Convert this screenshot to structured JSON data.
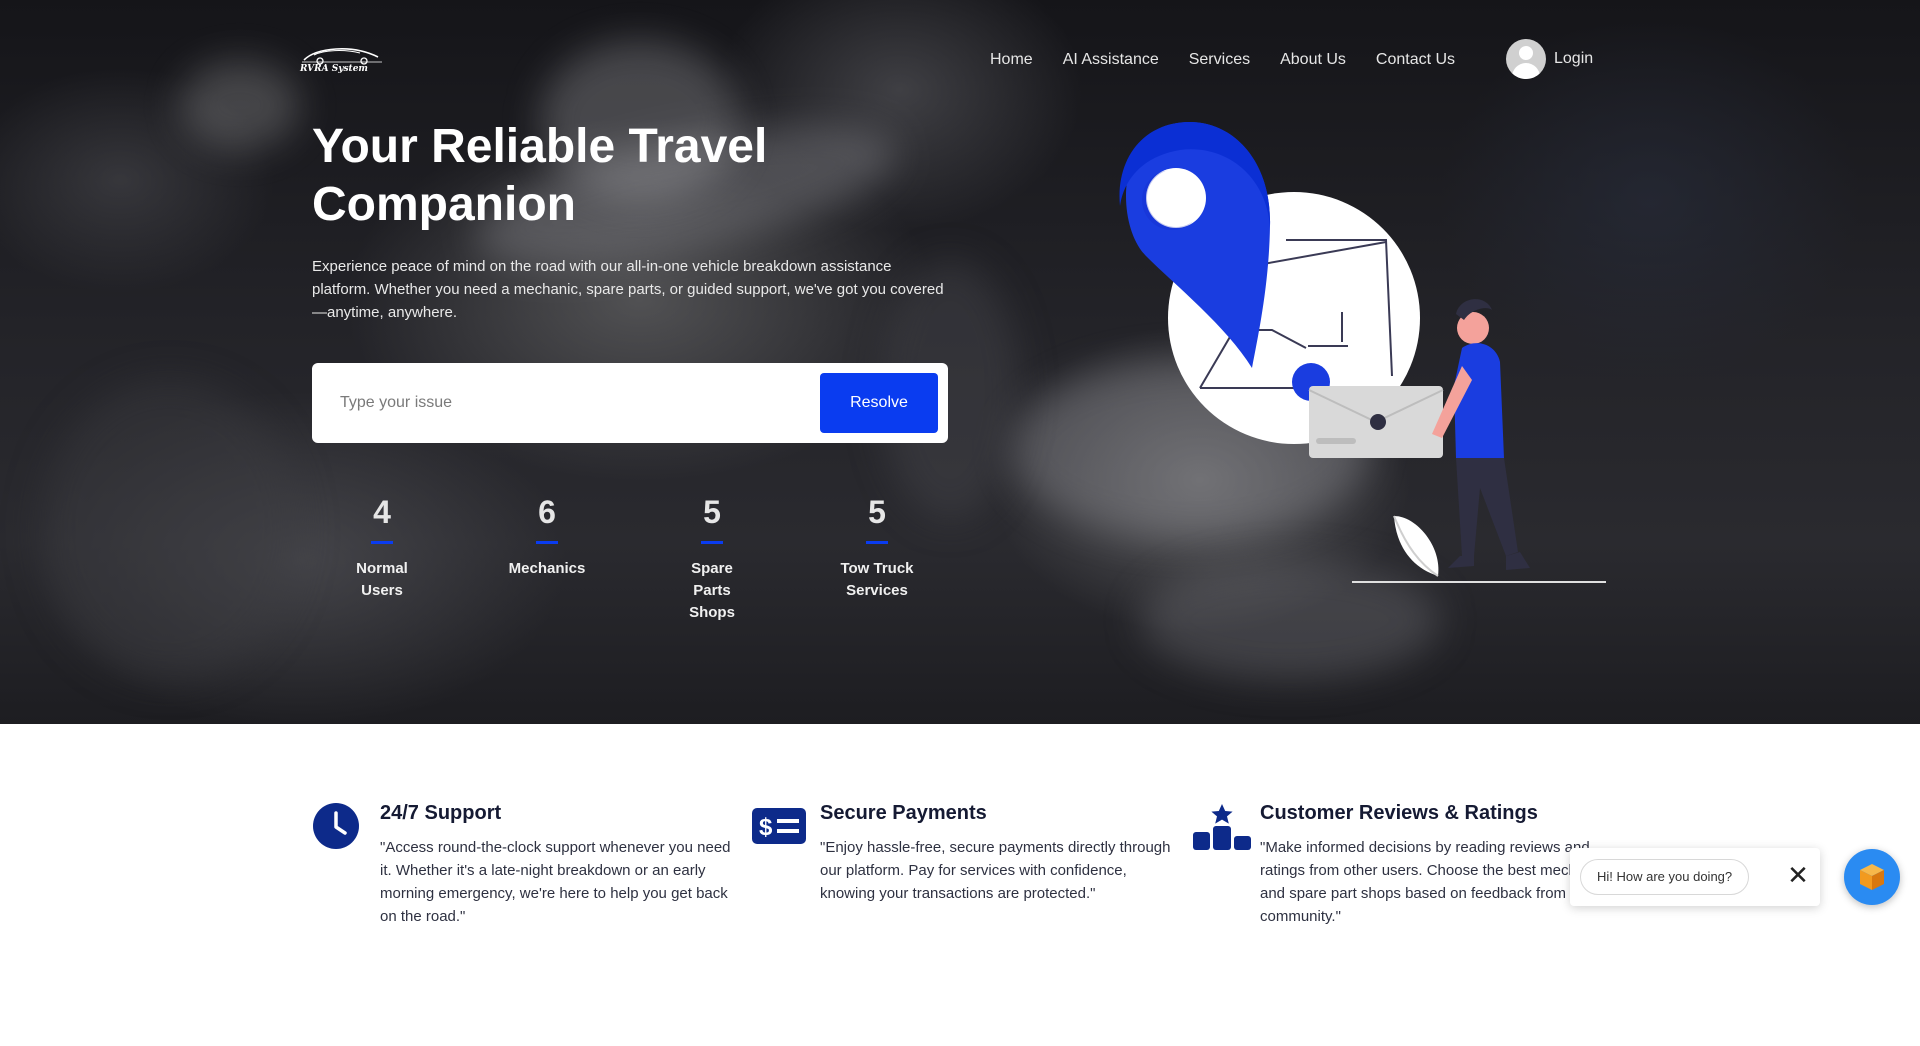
{
  "brand": {
    "logo_text": "RVRA System"
  },
  "nav": {
    "items": [
      "Home",
      "AI Assistance",
      "Services",
      "About Us",
      "Contact Us"
    ],
    "login_label": "Login"
  },
  "hero": {
    "title": "Your Reliable Travel Companion",
    "description": "Experience peace of mind on the road with our all-in-one vehicle breakdown assistance platform. Whether you need a mechanic, spare parts, or guided support, we've got you covered—anytime, anywhere.",
    "search_placeholder": "Type your issue",
    "resolve_label": "Resolve"
  },
  "stats": [
    {
      "value": "4",
      "label": "Normal Users"
    },
    {
      "value": "6",
      "label": "Mechanics"
    },
    {
      "value": "5",
      "label": "Spare Parts Shops"
    },
    {
      "value": "5",
      "label": "Tow Truck Services"
    }
  ],
  "features": [
    {
      "icon": "clock-icon",
      "title": "24/7 Support",
      "description": "\"Access round-the-clock support whenever you need it. Whether it's a late-night breakdown or an early morning emergency, we're here to help you get back on the road.\""
    },
    {
      "icon": "payment-icon",
      "title": "Secure Payments",
      "description": "\"Enjoy hassle-free, secure payments directly through our platform. Pay for services with confidence, knowing your transactions are protected.\""
    },
    {
      "icon": "ratings-podium-icon",
      "title": "Customer Reviews & Ratings",
      "description": "\"Make informed decisions by reading reviews and ratings from other users. Choose the best mechanics and spare part shops based on feedback from our community.\""
    }
  ],
  "chat": {
    "greeting": "Hi! How are you doing?"
  },
  "colors": {
    "accent": "#0a3cf0",
    "dark_navy": "#0d2a8a",
    "chat_launcher": "#2a8bf2",
    "launcher_cube": "#f29a1f"
  }
}
